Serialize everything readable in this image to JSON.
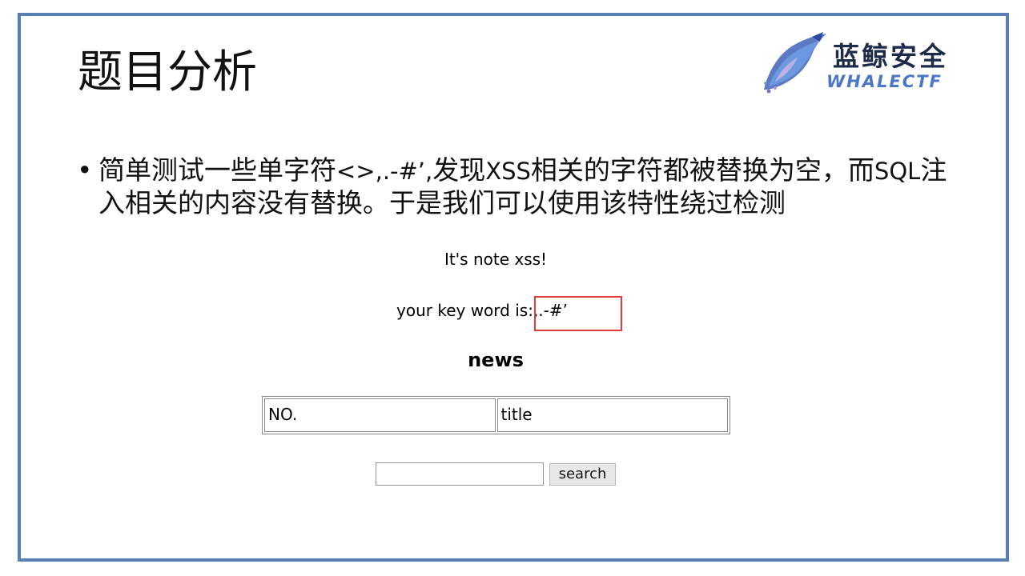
{
  "slide": {
    "title": "题目分析",
    "bullet_dot": "•",
    "bullet_parts": {
      "p1": "简单测试一些单字符",
      "p2": "<>,.-#’,",
      "p3": "发现",
      "p4": "XSS",
      "p5": "相关的字符都被替换为空，而",
      "p6": "SQL",
      "p7": "注入相关的内容没有替换。于是我们可以使用该特性绕过检测"
    }
  },
  "logo": {
    "name_cn": "蓝鲸安全",
    "name_en": "WHALECTF",
    "icon": "whale-logo-icon"
  },
  "webpage": {
    "heading": "It's note xss!",
    "keyword_label": "your key word is:",
    "keyword_value": ",.-#’",
    "news_heading": "news",
    "table_headers": [
      "NO.",
      "title"
    ],
    "search_placeholder": "",
    "search_button": "search"
  },
  "colors": {
    "frame": "#5a7fb5",
    "highlight": "#e03a3a",
    "logo_blue": "#4a77c8",
    "logo_dark": "#1e2a4a"
  }
}
